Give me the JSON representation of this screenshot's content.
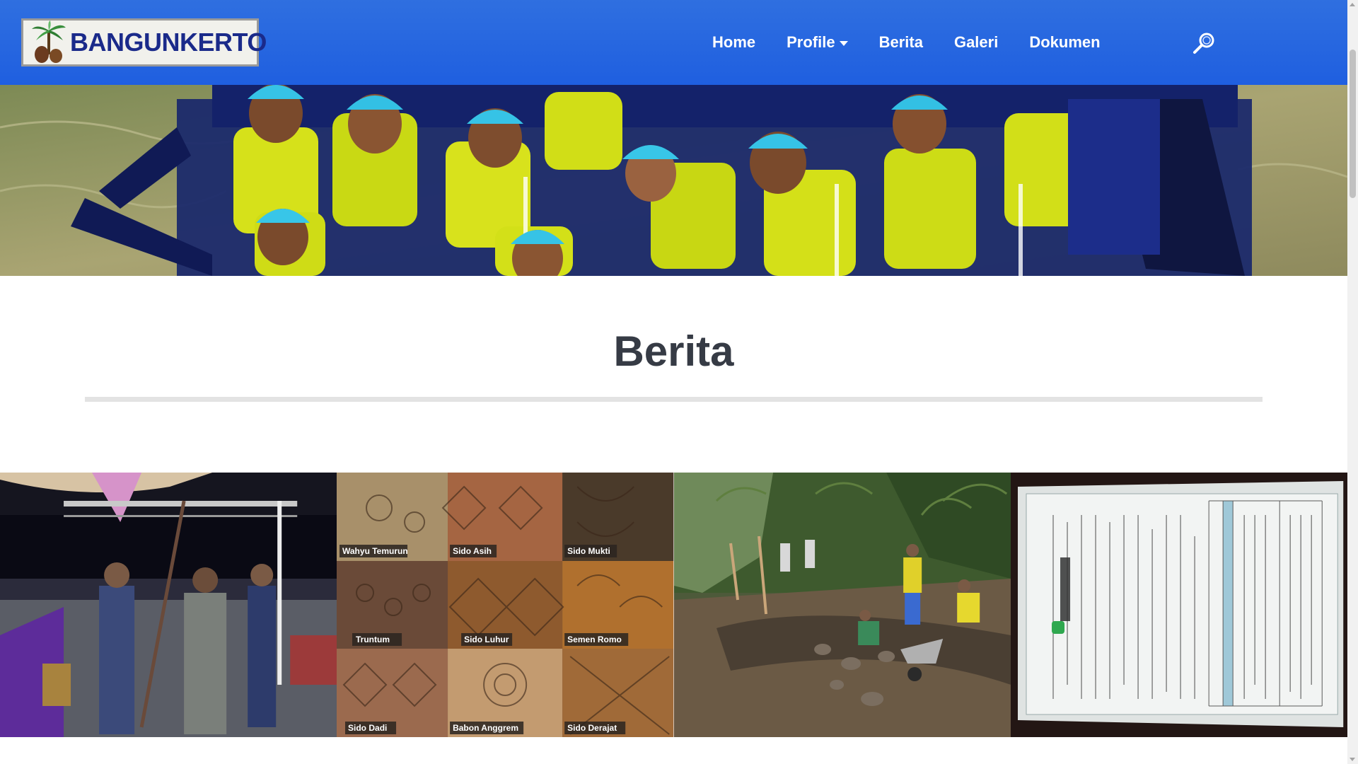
{
  "header": {
    "brand_text": "BANGUNKERTO",
    "nav": [
      {
        "label": "Home"
      },
      {
        "label": "Profile",
        "has_dropdown": true
      },
      {
        "label": "Berita"
      },
      {
        "label": "Galeri"
      },
      {
        "label": "Dokumen"
      }
    ],
    "search_icon": "search-icon",
    "colors": {
      "navbar": "#1f5fe0",
      "brand_text": "#1a2a8a"
    }
  },
  "hero": {
    "image": "rafting-group-photo"
  },
  "section": {
    "title": "Berita"
  },
  "news": {
    "items": [
      {
        "image": "ceremony-night-photo"
      },
      {
        "image": "batik-patterns-photo",
        "labels": [
          "Wahyu Temurun",
          "Sido Asih",
          "Sido Mukti",
          "Truntum",
          "Sido Luhur",
          "Semen Romo",
          "Sido Dadi",
          "Babon Anggrem",
          "Sido Derajat"
        ]
      },
      {
        "image": "road-work-photo"
      },
      {
        "image": "service-notice-document-photo"
      }
    ]
  }
}
